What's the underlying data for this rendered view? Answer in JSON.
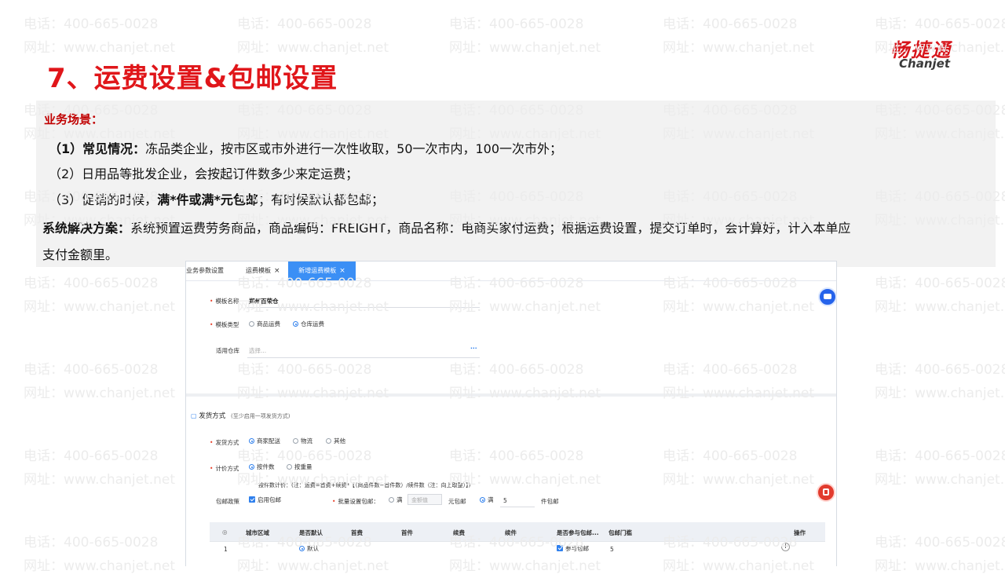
{
  "watermark": {
    "phone": "电话：400-665-0028",
    "site": "网址：www.chanjet.net"
  },
  "logo": {
    "cn": "畅捷通",
    "en": "Chanjet"
  },
  "page_title": "7、运费设置&包邮设置",
  "scenario": {
    "heading": "业务场景：",
    "item1_prefix": "（1）常见情况：",
    "item1_text": "冻品类企业，按市区或市外进行一次性收取，50一次市内，100一次市外；",
    "item2": "（2）日用品等批发企业，会按起订件数多少来定运费；",
    "item3_a": "（3）促销的时候，",
    "item3_b": "满*件或满*元包邮",
    "item3_c": "；有时候默认都包邮；",
    "solution_prefix": "系统解决方案：",
    "solution_line1": "系统预置运费劳务商品，商品编码：FREIGHT，商品名称：电商买家付运费；根据运费设置，提交订单时，会计算好，计入本单应",
    "solution_line2": "支付金额里。"
  },
  "app": {
    "tabs": [
      {
        "label": "业务参数设置"
      },
      {
        "label": "运费模板"
      },
      {
        "label": "新增运费模板"
      }
    ],
    "form": {
      "template_name_label": "模板名称",
      "template_name_value": "郑州百荣仓",
      "template_type_label": "模板类型",
      "template_type_options": [
        "商品运费",
        "仓库运费"
      ],
      "warehouse_label": "适用仓库",
      "warehouse_placeholder": "选择...",
      "more_icon": "···"
    },
    "shipping": {
      "section_title": "发货方式",
      "section_hint": "(至少启用一项发货方式)",
      "method_label": "发货方式",
      "method_options": [
        "商家配送",
        "物流",
        "其他"
      ],
      "pricing_label": "计价方式",
      "pricing_options": [
        "按件数",
        "按重量"
      ],
      "formula": "按件数计价：(注：运费=首费+续费*【（商品件数−首件数）/续件数（注：向上取整）】)",
      "free_policy_label": "包邮政策",
      "free_policy_enable": "启用包邮",
      "batch_label": "批量设置包邮：",
      "opt_amount": "满",
      "amount_placeholder": "金额值",
      "unit_yuan": "元包邮",
      "opt_qty": "满",
      "qty_value": "5",
      "unit_piece": "件包邮"
    },
    "table": {
      "headers": [
        "◎",
        "城市区域",
        "是否默认运费规则",
        "首费",
        "首件",
        "续费",
        "续件",
        "是否参与包邮...",
        "包邮门槛",
        "操作"
      ],
      "rows": [
        {
          "index": "1",
          "city": "",
          "default": "默认",
          "first_fee": "",
          "first_qty": "",
          "next_fee": "",
          "next_qty": "",
          "free_join": "参与包邮",
          "threshold": "5",
          "action": "+"
        }
      ]
    }
  }
}
